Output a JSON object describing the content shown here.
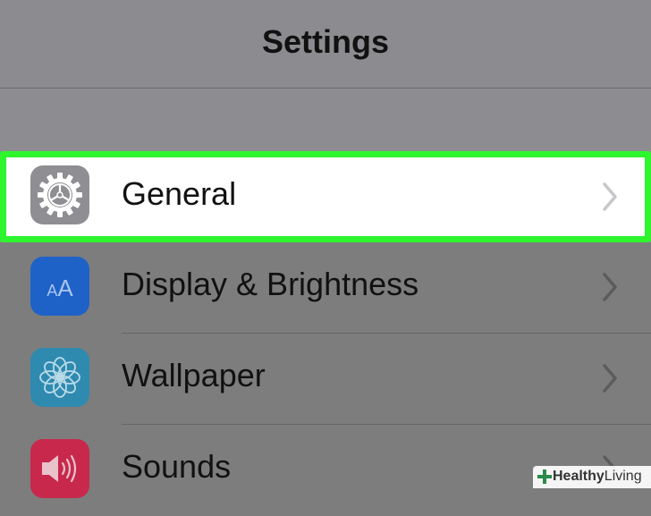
{
  "navbar": {
    "title": "Settings"
  },
  "rows": [
    {
      "label": "General",
      "icon": "gear-icon",
      "icon_bg": "#8e8e93",
      "highlighted": true
    },
    {
      "label": "Display & Brightness",
      "icon": "text-size-icon",
      "icon_bg": "#1e62c7"
    },
    {
      "label": "Wallpaper",
      "icon": "flower-icon",
      "icon_bg": "#2f8ab0"
    },
    {
      "label": "Sounds",
      "icon": "speaker-icon",
      "icon_bg": "#c8284c"
    }
  ],
  "display_icon_text": "AA",
  "highlight_color": "#2ef52e",
  "watermark": {
    "bold": "Healthy",
    "rest": "Living"
  }
}
